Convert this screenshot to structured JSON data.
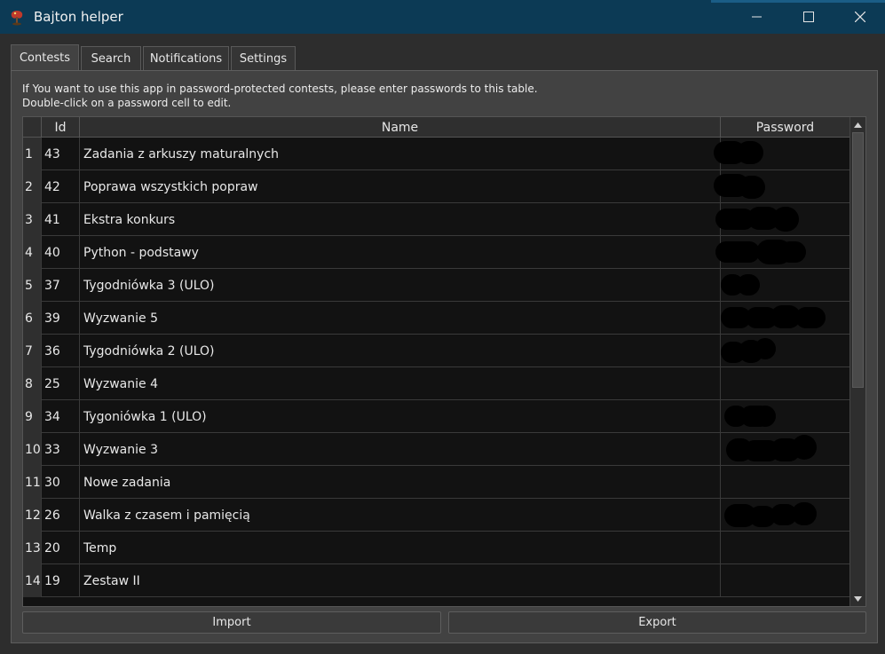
{
  "window": {
    "title": "Bajton helper"
  },
  "tabs": [
    {
      "label": "Contests",
      "active": true
    },
    {
      "label": "Search",
      "active": false
    },
    {
      "label": "Notifications",
      "active": false
    },
    {
      "label": "Settings",
      "active": false
    }
  ],
  "info": {
    "line1": "If You want to use this app in password-protected contests, please enter passwords to this table.",
    "line2": "Double-click on a password cell to edit."
  },
  "table": {
    "headers": [
      "Id",
      "Name",
      "Password"
    ],
    "rows": [
      {
        "num": "1",
        "id": "43",
        "name": "Zadania z arkuszy maturalnych",
        "password_hidden": true
      },
      {
        "num": "2",
        "id": "42",
        "name": "Poprawa wszystkich popraw",
        "password_hidden": true
      },
      {
        "num": "3",
        "id": "41",
        "name": "Ekstra konkurs",
        "password_hidden": true
      },
      {
        "num": "4",
        "id": "40",
        "name": "Python - podstawy",
        "password_hidden": true
      },
      {
        "num": "5",
        "id": "37",
        "name": "Tygodniówka 3 (ULO)",
        "password_hidden": true
      },
      {
        "num": "6",
        "id": "39",
        "name": "Wyzwanie 5",
        "password_hidden": true
      },
      {
        "num": "7",
        "id": "36",
        "name": "Tygodniówka 2 (ULO)",
        "password_hidden": true
      },
      {
        "num": "8",
        "id": "25",
        "name": "Wyzwanie 4",
        "password_hidden": false
      },
      {
        "num": "9",
        "id": "34",
        "name": "Tygoniówka 1 (ULO)",
        "password_hidden": true
      },
      {
        "num": "10",
        "id": "33",
        "name": "Wyzwanie 3",
        "password_hidden": true
      },
      {
        "num": "11",
        "id": "30",
        "name": "Nowe zadania",
        "password_hidden": false
      },
      {
        "num": "12",
        "id": "26",
        "name": "Walka z czasem i pamięcią",
        "password_hidden": true
      },
      {
        "num": "13",
        "id": "20",
        "name": "Temp",
        "password_hidden": false
      },
      {
        "num": "14",
        "id": "19",
        "name": "Zestaw II",
        "password_hidden": false
      }
    ]
  },
  "buttons": {
    "import_label": "Import",
    "export_label": "Export"
  },
  "colors": {
    "titlebar": "#0c3a55",
    "panel": "#424242",
    "table_bg": "#121212"
  },
  "icons": {
    "app": "bajton-app-icon",
    "minimize": "minimize-icon",
    "maximize": "maximize-icon",
    "close": "close-icon"
  }
}
